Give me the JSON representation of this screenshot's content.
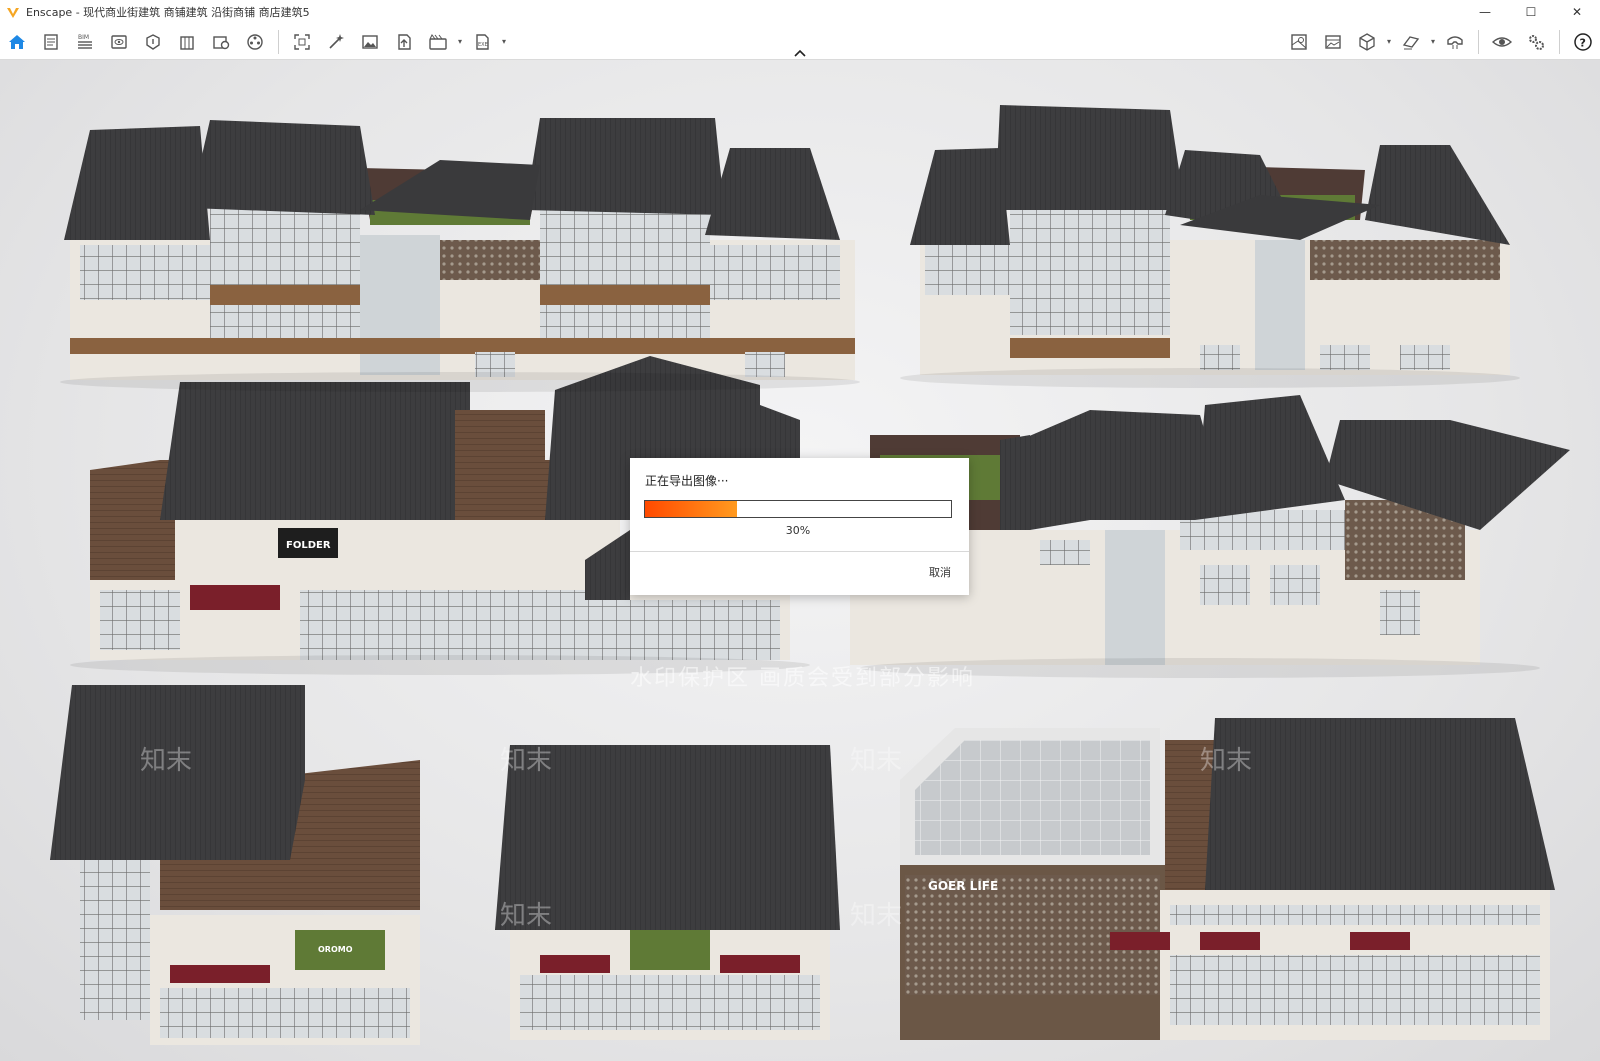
{
  "window": {
    "title": "Enscape - 现代商业街建筑 商铺建筑 沿街商铺 商店建筑5",
    "minimize_glyph": "—",
    "maximize_glyph": "☐",
    "close_glyph": "✕"
  },
  "toolbar": {
    "left_tools": [
      {
        "icon": "home-icon"
      },
      {
        "icon": "notes-icon"
      },
      {
        "icon": "bim-icon"
      },
      {
        "icon": "views-icon"
      },
      {
        "icon": "site-context-icon"
      },
      {
        "icon": "building-icon"
      },
      {
        "icon": "asset-library-icon"
      },
      {
        "icon": "material-editor-icon"
      },
      {
        "icon": "screenshot-icon"
      },
      {
        "icon": "magic-wand-icon"
      },
      {
        "icon": "image-export-icon"
      },
      {
        "icon": "upload-icon"
      },
      {
        "icon": "video-icon"
      },
      {
        "icon": "exe-export-icon"
      }
    ],
    "right_tools": [
      {
        "icon": "map-icon"
      },
      {
        "icon": "panorama-icon"
      },
      {
        "icon": "cube-icon"
      },
      {
        "icon": "section-icon"
      },
      {
        "icon": "vr-headset-icon"
      },
      {
        "icon": "eye-icon"
      },
      {
        "icon": "settings-icon"
      },
      {
        "icon": "help-icon"
      }
    ],
    "accent_color": "#1e88e5"
  },
  "dialog": {
    "title": "正在导出图像···",
    "progress": 0.3,
    "progress_label": "30%",
    "cancel_label": "取消",
    "fill_from": "#ff4a00",
    "fill_to": "#ff9a1f"
  },
  "viewport": {
    "watermark_text": "水印保护区  画质会受到部分影响",
    "watermark_brand": "知末",
    "storefront_signs": [
      "FOLDER",
      "OROMO",
      "GOER LIFE"
    ]
  }
}
